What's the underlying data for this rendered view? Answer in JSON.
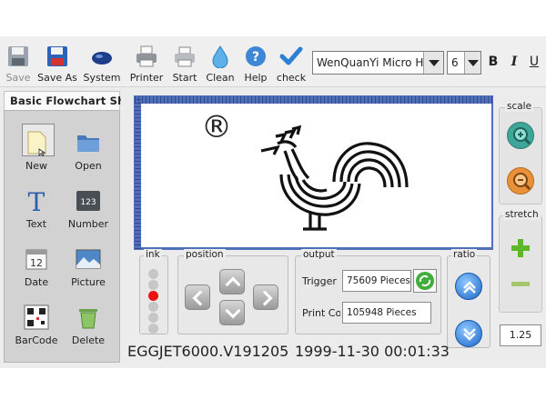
{
  "toolbar": {
    "items": [
      {
        "label": "Save",
        "icon": "floppy-disk-icon",
        "enabled": false
      },
      {
        "label": "Save As",
        "icon": "floppy-disk-icon",
        "enabled": true
      },
      {
        "label": "System",
        "icon": "mouse-icon",
        "enabled": true
      },
      {
        "label": "Printer",
        "icon": "printer-icon",
        "enabled": true
      },
      {
        "label": "Start",
        "icon": "printer-start-icon",
        "enabled": true
      },
      {
        "label": "Clean",
        "icon": "water-drop-icon",
        "enabled": true
      },
      {
        "label": "Help",
        "icon": "help-icon",
        "enabled": true
      },
      {
        "label": "check",
        "icon": "checkmark-icon",
        "enabled": true
      }
    ],
    "font": "WenQuanYi Micro Hei",
    "font_size": "6",
    "bold": "B",
    "italic": "I",
    "underline": "U"
  },
  "shapes_panel": {
    "title": "Basic Flowchart Shap",
    "items": [
      {
        "label": "New",
        "icon": "new-document-icon",
        "selected": true
      },
      {
        "label": "Open",
        "icon": "folder-icon",
        "selected": false
      },
      {
        "label": "Text",
        "icon": "text-icon",
        "selected": false
      },
      {
        "label": "Number",
        "icon": "number-icon",
        "selected": false
      },
      {
        "label": "Date",
        "icon": "calendar-icon",
        "selected": false
      },
      {
        "label": "Picture",
        "icon": "picture-icon",
        "selected": false
      },
      {
        "label": "BarCode",
        "icon": "qr-code-icon",
        "selected": false
      },
      {
        "label": "Delete",
        "icon": "trash-icon",
        "selected": false
      }
    ]
  },
  "canvas": {
    "symbol": "®",
    "image": "rooster-logo"
  },
  "scale": {
    "label": "scale"
  },
  "stretch": {
    "label": "stretch",
    "value": "1.25"
  },
  "ink": {
    "label": "ink",
    "levels": 6,
    "active_level": 3
  },
  "position": {
    "label": "position"
  },
  "output": {
    "label": "output",
    "trigger_label": "Trigger C",
    "trigger_value": "75609  Pieces",
    "print_label": "Print Cou",
    "print_value": "105948  Pieces"
  },
  "ratio": {
    "label": "ratio"
  },
  "status": {
    "version": "EGGJET6000.V191205",
    "datetime": "1999-11-30 00:01:33"
  },
  "colors": {
    "accent": "#4f6fb8",
    "ink_active": "#ee1111",
    "add": "#5cb82a"
  }
}
